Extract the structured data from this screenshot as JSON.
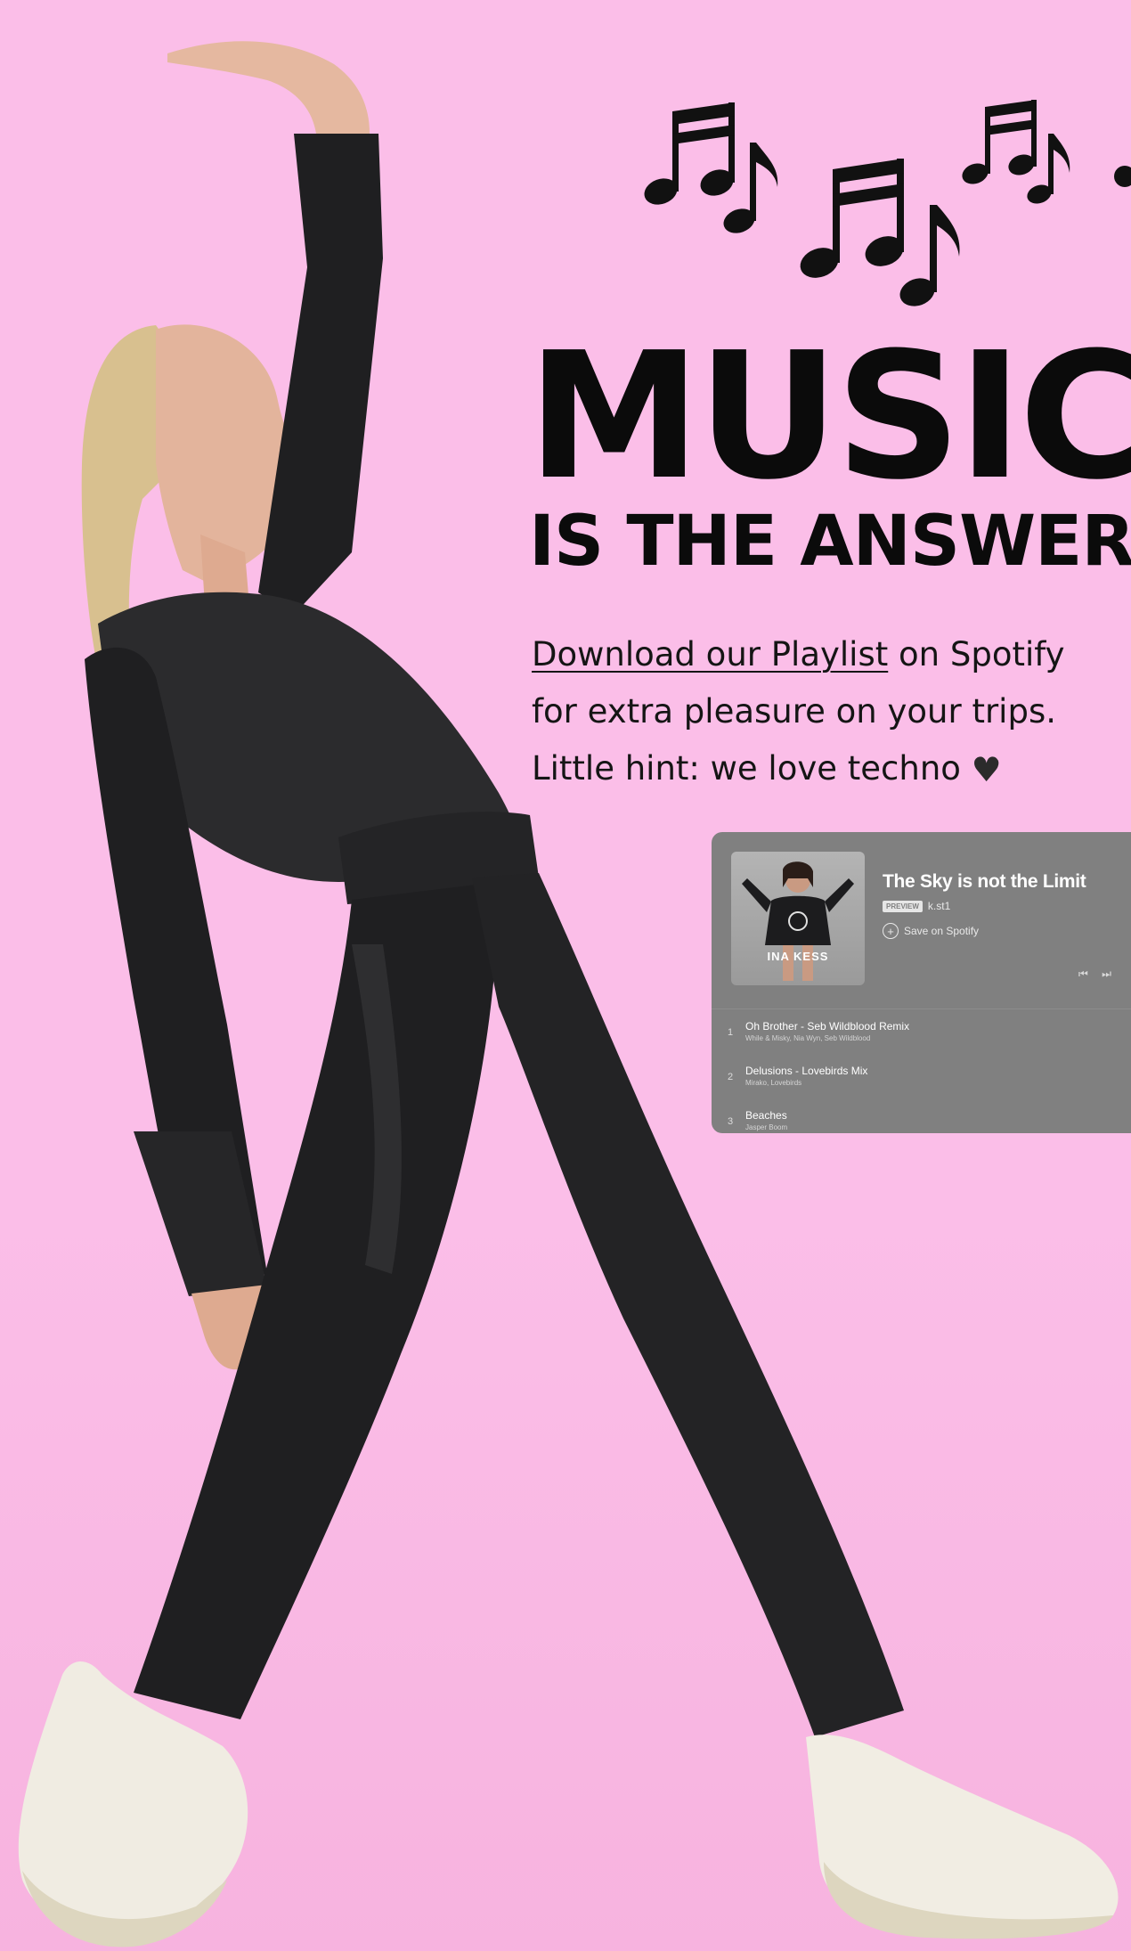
{
  "heading": {
    "music": "MUSIC",
    "subtitle": "IS THE ANSWER"
  },
  "intro": {
    "link_text": "Download our Playlist",
    "line1_rest": " on Spotify",
    "line2": "for extra pleasure on your trips.",
    "line3": "Little hint: we love techno",
    "heart_glyph": "♥"
  },
  "spotify_embed": {
    "cover_label": "INA KESS",
    "title": "The Sky is not the Limit",
    "badge": "PREVIEW",
    "owner": "k.st1",
    "save_label": "Save on Spotify",
    "plus_glyph": "+",
    "controls": "⏮ ⏭",
    "tracks": [
      {
        "number": "1",
        "title": "Oh Brother - Seb Wildblood Remix",
        "artists": "While & Misky, Nia Wyn, Seb Wildblood"
      },
      {
        "number": "2",
        "title": "Delusions - Lovebirds Mix",
        "artists": "Mirako, Lovebirds"
      },
      {
        "number": "3",
        "title": "Beaches",
        "artists": "Jasper Boom"
      }
    ]
  },
  "colors": {
    "background": "#fbbee8",
    "text": "#0b0b0b",
    "embed_bg": "#808080",
    "outfit": "#1f1f21"
  },
  "icons": {
    "notes": "music-notes-icon",
    "heart": "heart-icon",
    "save": "plus-circle-icon",
    "controls": "skip-controls-icon"
  }
}
